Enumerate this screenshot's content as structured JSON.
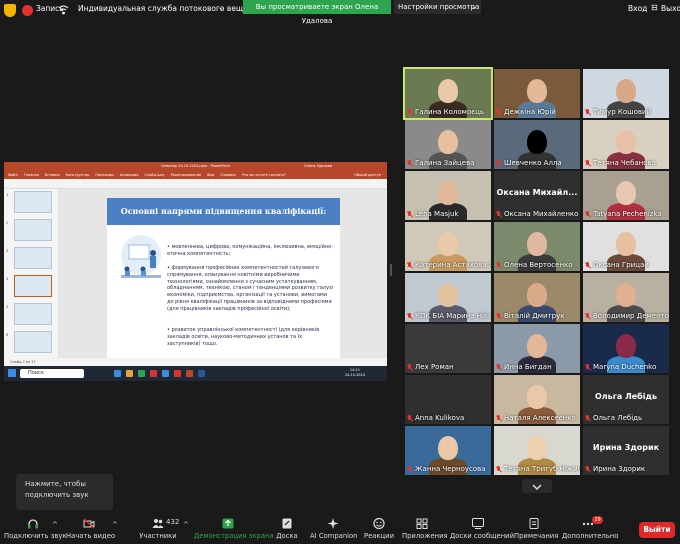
{
  "topbar": {
    "record": "Запись",
    "stream": "Индивидуальная служба потокового вещания",
    "viewing_banner": "Вы просматриваете экран Олена Удалова",
    "view_options": "Настройки просмотра",
    "login": "Вход",
    "exit_top": "Выход"
  },
  "powerpoint": {
    "title": "Семинар 24.10.2024.pptx - PowerPoint",
    "user": "Олена Удалова",
    "tabs": [
      "Файл",
      "Главная",
      "Вставка",
      "Конструктор",
      "Переходы",
      "Анимация",
      "Слайд-шоу",
      "Рецензирование",
      "Вид",
      "Справка",
      "Что вы хотите сделать?"
    ],
    "share": "Общий доступ",
    "thumb_numbers": [
      "1",
      "2",
      "3",
      "4",
      "5",
      "6"
    ],
    "slide_title": "Основні напрями підвищення кваліфікації:",
    "bullets": [
      "• мовленнєва, цифрова, комунікаційна, інклюзивна, емоційно-етична компетентність;",
      "• формування професійних компетентностей галузевого спрямування, опанування новітніми виробничими технологіями, ознайомлення з сучасним устаткуванням, обладнанням, технікою, станом і тенденціями розвитку галузі економіки, підприємства, організації та установи, вимогами до рівня кваліфікації працівників за відповідними професіями (для працівників закладів професійної освіти);",
      "• розвиток управлінської компетентності (для керівників закладів освіти, науково-методичних установ та їх заступників) тощо."
    ],
    "status": "Слайд 7 из 17",
    "search": "Поиск",
    "clock_time": "14:11",
    "clock_date": "24.10.2024"
  },
  "participants": [
    {
      "name": "Галина Коломоєць",
      "muted": true,
      "active": true
    },
    {
      "name": "Дежкіна Юрій",
      "muted": true
    },
    {
      "name": "Тимур Кошовий",
      "muted": true
    },
    {
      "name": "Галина Зайцева",
      "muted": true
    },
    {
      "name": "Шевченко Алла",
      "muted": true
    },
    {
      "name": "Тетяна Чебанова",
      "muted": true
    },
    {
      "name": "Lena Masjuk",
      "muted": true
    },
    {
      "name": "Оксана Михайленко",
      "muted": true,
      "big": "Оксана Михайл..."
    },
    {
      "name": "Tatyana Pechenizka",
      "muted": true
    },
    {
      "name": "Катерина Астахова Х...",
      "muted": true
    },
    {
      "name": "Олена Вертосенко",
      "muted": true
    },
    {
      "name": "Оксана Грицай",
      "muted": true
    },
    {
      "name": "КПК БІА Марина Нікі...",
      "muted": true
    },
    {
      "name": "Віталій Дмитрук",
      "muted": true
    },
    {
      "name": "Володимир Дементо...",
      "muted": true
    },
    {
      "name": "Лех Роман",
      "muted": true
    },
    {
      "name": "Инна Бигдан",
      "muted": true
    },
    {
      "name": "Maryna Duchenko",
      "muted": true
    },
    {
      "name": "Anna Kulikova",
      "muted": true
    },
    {
      "name": "Наталя Алексеєнко",
      "muted": true
    },
    {
      "name": "Ольга Лебідь",
      "muted": true,
      "big": "Ольга Лебідь"
    },
    {
      "name": "Жанна Черноусова",
      "muted": true
    },
    {
      "name": "Тетяна Тригуб Ніжин...",
      "muted": true
    },
    {
      "name": "Ирина Здорик",
      "muted": true,
      "big": "Ирина Здорик"
    }
  ],
  "tooltip": {
    "line1": "Нажмите, чтобы",
    "line2": "подключить звук"
  },
  "toolbar": {
    "audio": "Подключить звук",
    "video": "Начать видео",
    "participants": "Участники",
    "participants_count": "432",
    "share": "Демонстрация экрана",
    "whiteboard": "Доска",
    "ai": "AI Companion",
    "reactions": "Реакции",
    "apps": "Приложения",
    "boards": "Доски сообщений",
    "notes": "Примечания",
    "more": "Дополнительно",
    "more_badge": "29",
    "leave": "Выйти"
  },
  "colors": {
    "accent_green": "#2da44e",
    "ppt_red": "#b7472a",
    "slide_blue": "#4a7fc1",
    "leave_red": "#e02828"
  }
}
